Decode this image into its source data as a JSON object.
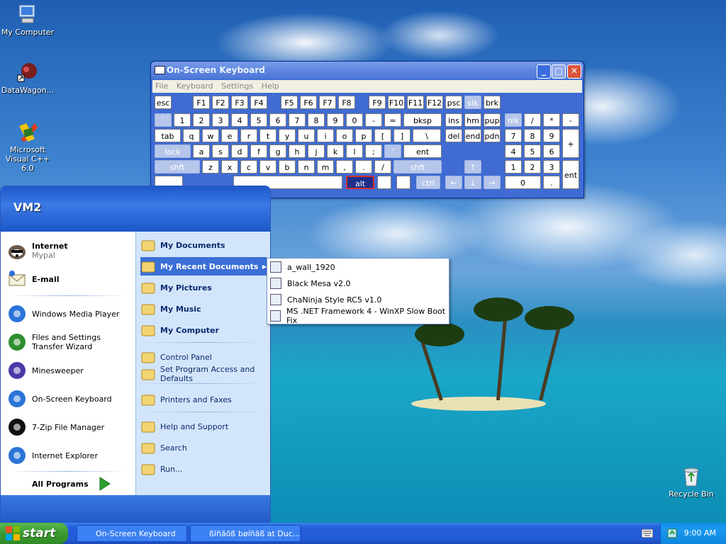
{
  "desktop": {
    "icons": [
      {
        "label": "My Computer",
        "icon": "my-computer-icon"
      },
      {
        "label": "DataWagon...",
        "icon": "datawagon-icon"
      },
      {
        "label": "Microsoft Visual C++ 6.0",
        "icon": "visual-cpp-icon"
      },
      {
        "label": "Recycle Bin",
        "icon": "recycle-bin-icon"
      }
    ]
  },
  "osk": {
    "title": "On-Screen Keyboard",
    "menu": [
      "File",
      "Keyboard",
      "Settings",
      "Help"
    ],
    "keys": {
      "row0": [
        "esc",
        "F1",
        "F2",
        "F3",
        "F4",
        "F5",
        "F6",
        "F7",
        "F8",
        "F9",
        "F10",
        "F11",
        "F12",
        "psc",
        "slk",
        "brk"
      ],
      "row1": [
        "`",
        "1",
        "2",
        "3",
        "4",
        "5",
        "6",
        "7",
        "8",
        "9",
        "0",
        "-",
        "=",
        "bksp",
        "ins",
        "hm",
        "pup",
        "nlk",
        "/",
        "*",
        "-"
      ],
      "row2": [
        "tab",
        "q",
        "w",
        "e",
        "r",
        "t",
        "y",
        "u",
        "i",
        "o",
        "p",
        "[",
        "]",
        "\\",
        "del",
        "end",
        "pdn",
        "7",
        "8",
        "9",
        "+"
      ],
      "row3": [
        "lock",
        "a",
        "s",
        "d",
        "f",
        "g",
        "h",
        "j",
        "k",
        "l",
        ";",
        "'",
        "ent",
        "4",
        "5",
        "6"
      ],
      "row4": [
        "shft",
        "z",
        "x",
        "c",
        "v",
        "b",
        "n",
        "m",
        ",",
        ".",
        "/",
        "shft",
        "↑",
        "1",
        "2",
        "3",
        "ent"
      ],
      "row5": [
        "alt",
        "ctrl",
        "←",
        "↓",
        "→",
        "0",
        "."
      ]
    }
  },
  "startmenu": {
    "user": "VM2",
    "pinned": [
      {
        "title": "Internet",
        "sub": "Mypal",
        "icon": "mypal-icon"
      },
      {
        "title": "E-mail",
        "sub": "",
        "icon": "email-icon"
      }
    ],
    "recent_programs": [
      {
        "label": "Windows Media Player",
        "icon": "media-player-icon"
      },
      {
        "label": "Files and Settings Transfer Wizard",
        "icon": "transfer-wizard-icon"
      },
      {
        "label": "Minesweeper",
        "icon": "minesweeper-icon"
      },
      {
        "label": "On-Screen Keyboard",
        "icon": "osk-icon"
      },
      {
        "label": "7-Zip File Manager",
        "icon": "7zip-icon"
      },
      {
        "label": "Internet Explorer",
        "icon": "ie-icon"
      }
    ],
    "all_programs": "All Programs",
    "right": [
      {
        "label": "My Documents",
        "icon": "folder-icon",
        "bold": true
      },
      {
        "label": "My Recent Documents",
        "icon": "recent-docs-icon",
        "bold": true
      },
      {
        "label": "My Pictures",
        "icon": "pictures-icon",
        "bold": true
      },
      {
        "label": "My Music",
        "icon": "music-icon",
        "bold": true
      },
      {
        "label": "My Computer",
        "icon": "my-computer-icon",
        "bold": true
      },
      {
        "label": "Control Panel",
        "icon": "control-panel-icon",
        "bold": false
      },
      {
        "label": "Set Program Access and Defaults",
        "icon": "program-access-icon",
        "bold": false
      },
      {
        "label": "Printers and Faxes",
        "icon": "printer-icon",
        "bold": false
      },
      {
        "label": "Help and Support",
        "icon": "help-icon",
        "bold": false
      },
      {
        "label": "Search",
        "icon": "search-icon",
        "bold": false
      },
      {
        "label": "Run...",
        "icon": "run-icon",
        "bold": false
      }
    ],
    "recent_docs": [
      "a_wall_1920",
      "Black Mesa v2.0",
      "ChaNinja Style RC5 v1.0",
      "MS .NET Framework 4 - WinXP Slow Boot Fix"
    ]
  },
  "taskbar": {
    "start": "start",
    "tasks": [
      "On-Screen Keyboard",
      "ßíñãõß bøíñãß at Duc..."
    ],
    "clock": "9:00 AM"
  },
  "colors": {
    "accent": "#245edb",
    "start_green": "#3c9a31",
    "highlight": "#3a6fd6"
  }
}
